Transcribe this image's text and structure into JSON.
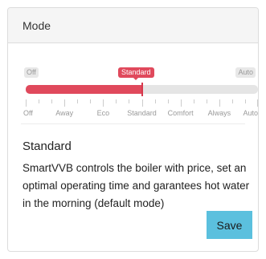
{
  "panel": {
    "title": "Mode"
  },
  "slider": {
    "min_label": "Off",
    "max_label": "Auto",
    "current_label": "Standard",
    "selected_index": 3,
    "selected_fraction": 0.5,
    "steps": [
      "Off",
      "Away",
      "Eco",
      "Standard",
      "Comfort",
      "Always",
      "Auto"
    ],
    "accent_color": "#e0495c",
    "track_color": "#e5e5e5"
  },
  "mode_info": {
    "title": "Standard",
    "description": "SmartVVB controls the boiler with price, set an optimal operating time and garantees hot water in the morning (default mode)"
  },
  "actions": {
    "save_label": "Save",
    "save_color": "#5bc0de"
  }
}
